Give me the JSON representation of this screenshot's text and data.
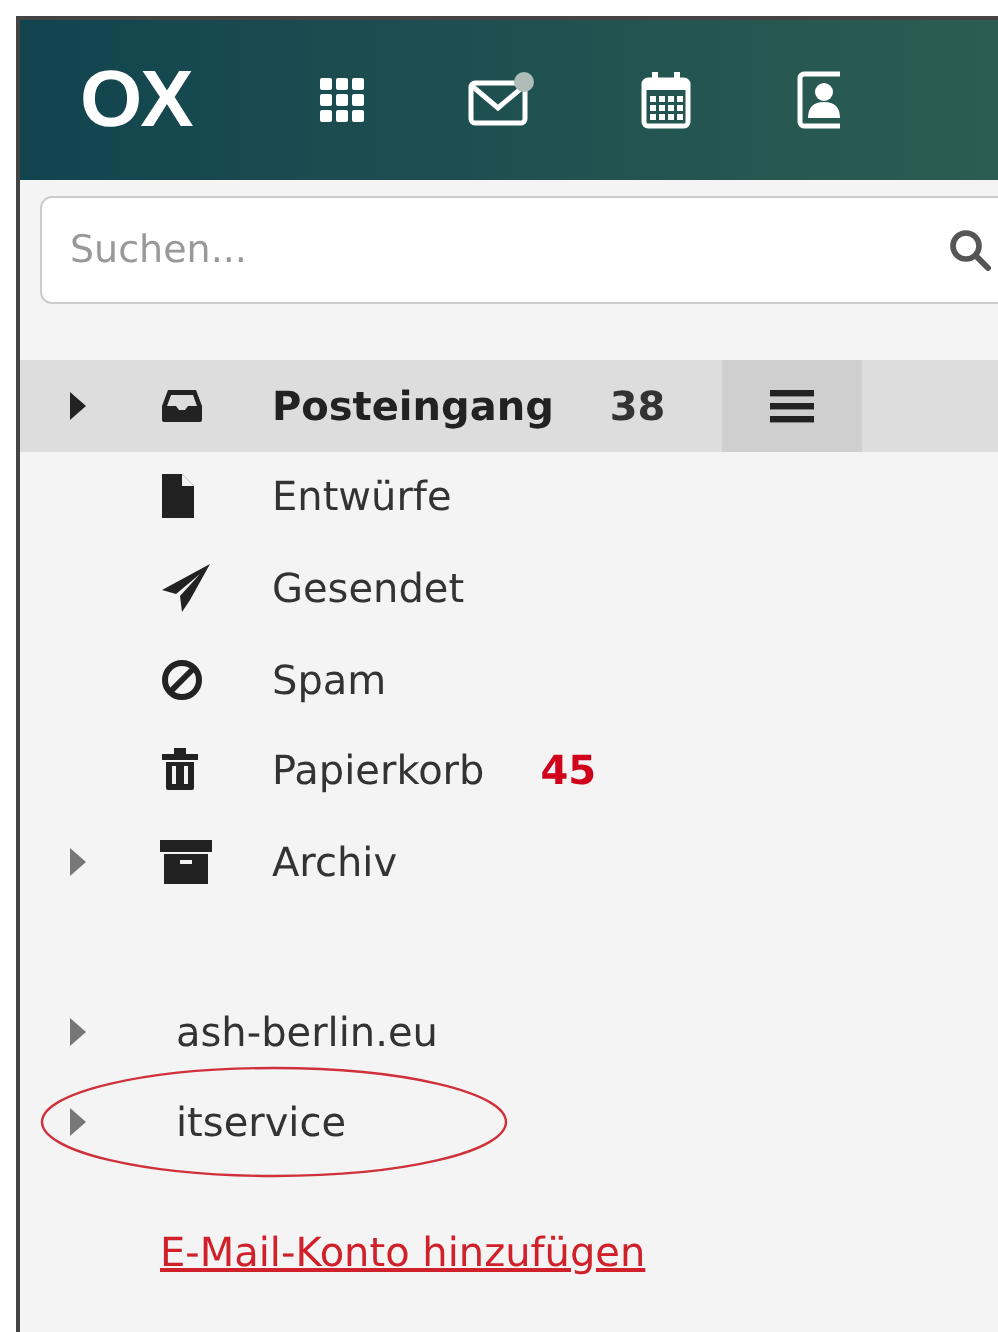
{
  "header": {
    "logo": "OX",
    "apps": [
      {
        "kind": "grid"
      },
      {
        "kind": "mail",
        "notification": true
      },
      {
        "kind": "calendar"
      },
      {
        "kind": "contacts"
      }
    ]
  },
  "search": {
    "placeholder": "Suchen..."
  },
  "folders": [
    {
      "label": "Posteingang",
      "kind": "inbox",
      "expandable": true,
      "selected": true,
      "count": "38",
      "color": "#333333"
    },
    {
      "label": "Entwürfe",
      "kind": "file",
      "expandable": false,
      "selected": false
    },
    {
      "label": "Gesendet",
      "kind": "send",
      "expandable": false,
      "selected": false
    },
    {
      "label": "Spam",
      "kind": "ban",
      "expandable": false,
      "selected": false
    },
    {
      "label": "Papierkorb",
      "kind": "trash",
      "expandable": false,
      "selected": false,
      "count": "45",
      "color": "#d0021b"
    },
    {
      "label": "Archiv",
      "kind": "archive",
      "expandable": true,
      "selected": false
    }
  ],
  "accounts": [
    {
      "label": "ash-berlin.eu",
      "circled": false
    },
    {
      "label": "itservice",
      "circled": true
    }
  ],
  "add_account_link": "E-Mail-Konto hinzufügen"
}
